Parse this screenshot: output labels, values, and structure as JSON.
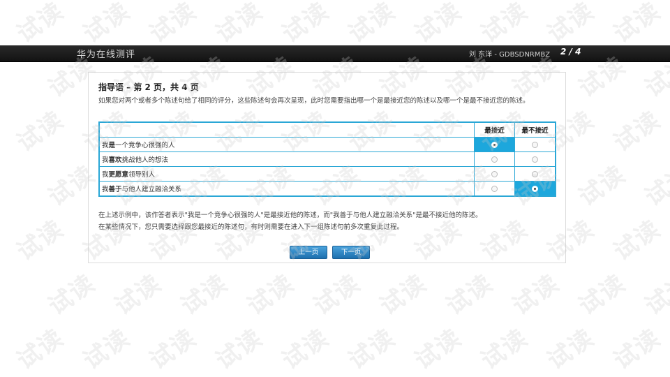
{
  "header": {
    "app_title": "华为在线测评",
    "user": "刘 东洋 - GDBSDNRMBZ",
    "page_indicator": "2 / 4"
  },
  "instructions": {
    "title": "指导语 – 第 2 页，共 4 页",
    "intro": "如果您对两个或者多个陈述句给了相同的评分，这些陈述句会再次呈现，此时您需要指出哪一个是最接近您的陈述以及哪一个是最不接近您的陈述。"
  },
  "table": {
    "columns": [
      "最接近",
      "最不接近"
    ],
    "rows": [
      {
        "pre": "我",
        "bold": "是",
        "post": "一个竞争心很强的人",
        "closest": true,
        "least": false
      },
      {
        "pre": "我",
        "bold": "喜欢",
        "post": "挑战他人的想法",
        "closest": false,
        "least": false
      },
      {
        "pre": "我",
        "bold": "更愿意",
        "post": "领导别人",
        "closest": false,
        "least": false
      },
      {
        "pre": "我",
        "bold": "善于",
        "post": "与他人建立融洽关系",
        "closest": false,
        "least": true
      }
    ]
  },
  "explanation": {
    "line1": "在上述示例中，该作答者表示\"我是一个竞争心很强的人\"是最接近他的陈述，而\"我善于与他人建立融洽关系\"是最不接近他的陈述。",
    "line2": "在某些情况下，您只需要选择跟您最接近的陈述句，有时则需要在进入下一组陈述句前多次重复此过程。"
  },
  "nav": {
    "prev_label": "上一页",
    "next_label": "下一页"
  },
  "watermark": "试读",
  "colors": {
    "accent": "#1da7dc",
    "topbar": "#1a1a1a",
    "button": "#1d6fae"
  }
}
